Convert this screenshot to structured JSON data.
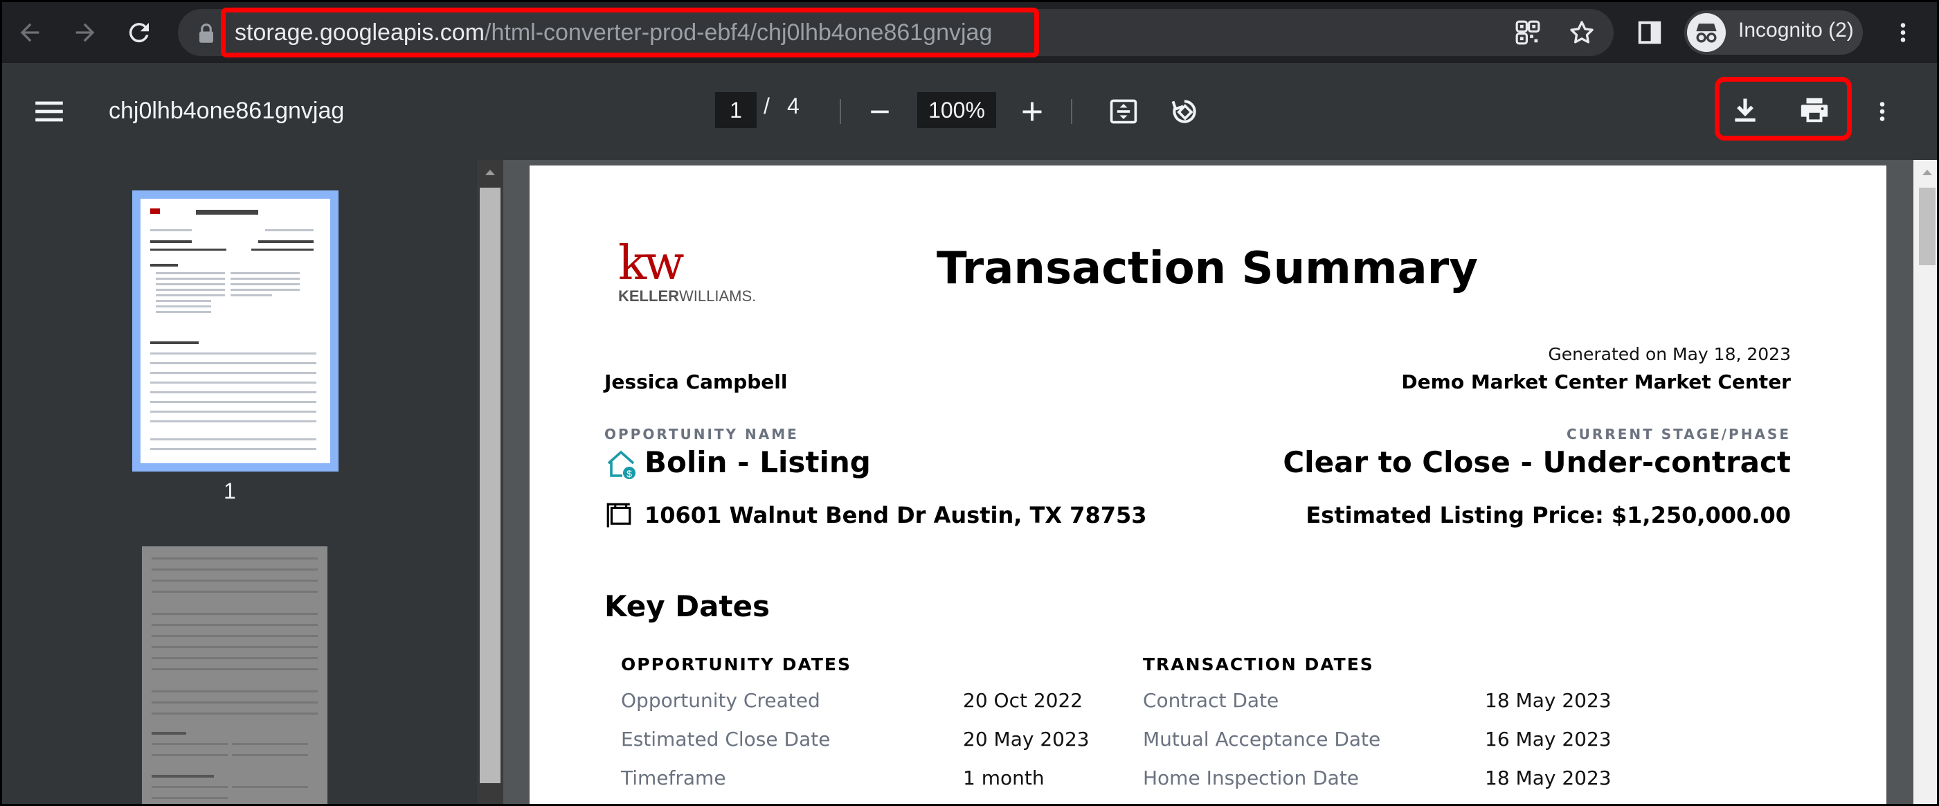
{
  "browser": {
    "url_host": "storage.googleapis.com",
    "url_path": "/html-converter-prod-ebf4/chj0lhb4one861gnvjag",
    "profile_label": "Incognito (2)"
  },
  "viewer": {
    "doc_title": "chj0lhb4one861gnvjag",
    "current_page": "1",
    "page_separator": "/",
    "total_pages": "4",
    "zoom": "100%",
    "thumbnail_label": "1"
  },
  "document": {
    "logo_mark": "kw",
    "logo_sub_a": "KELLER",
    "logo_sub_b": "WILLIAMS.",
    "title": "Transaction Summary",
    "generated": "Generated on May 18, 2023",
    "agent_name": "Jessica Campbell",
    "market_center": "Demo Market Center Market Center",
    "opportunity_label": "OPPORTUNITY NAME",
    "opportunity_name": "Bolin - Listing",
    "stage_label": "CURRENT STAGE/PHASE",
    "stage_value": "Clear to Close - Under-contract",
    "address": "10601 Walnut Bend Dr Austin, TX 78753",
    "price": "Estimated Listing Price: $1,250,000.00",
    "key_dates_heading": "Key Dates",
    "opportunity_dates_heading": "OPPORTUNITY DATES",
    "transaction_dates_heading": "TRANSACTION DATES",
    "opportunity_dates": [
      {
        "label": "Opportunity Created",
        "value": "20 Oct 2022"
      },
      {
        "label": "Estimated Close Date",
        "value": "20 May 2023"
      },
      {
        "label": "Timeframe",
        "value": "1 month"
      }
    ],
    "transaction_dates": [
      {
        "label": "Contract Date",
        "value": "18 May 2023"
      },
      {
        "label": "Mutual Acceptance Date",
        "value": "16 May 2023"
      },
      {
        "label": "Home Inspection Date",
        "value": "18 May 2023"
      }
    ]
  },
  "colors": {
    "highlight": "#ff0000",
    "thumbnail_selected": "#8ab4f8",
    "brand_red": "#b40101",
    "icon_teal": "#1a9aa8"
  }
}
